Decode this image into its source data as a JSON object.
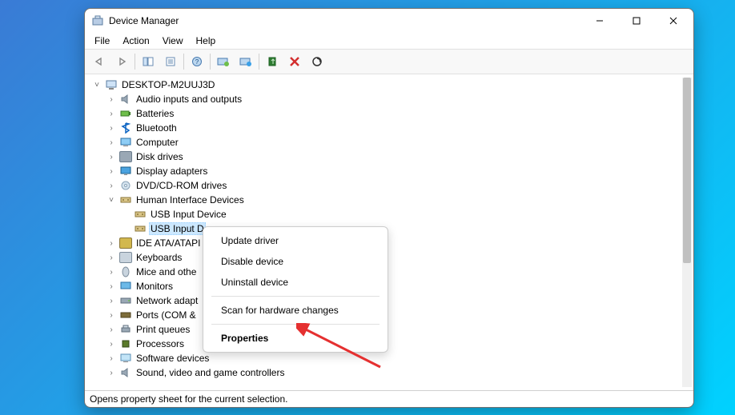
{
  "window": {
    "title": "Device Manager"
  },
  "menu": {
    "file": "File",
    "action": "Action",
    "view": "View",
    "help": "Help"
  },
  "toolbar_icons": [
    "back",
    "forward",
    "up",
    "show-hide",
    "help",
    "update",
    "uninstall",
    "disable",
    "scan",
    "add-legacy",
    "remove",
    "details"
  ],
  "tree": {
    "root": "DESKTOP-M2UUJ3D",
    "nodes": [
      {
        "label": "Audio inputs and outputs",
        "expanded": false
      },
      {
        "label": "Batteries",
        "expanded": false
      },
      {
        "label": "Bluetooth",
        "expanded": false
      },
      {
        "label": "Computer",
        "expanded": false
      },
      {
        "label": "Disk drives",
        "expanded": false
      },
      {
        "label": "Display adapters",
        "expanded": false
      },
      {
        "label": "DVD/CD-ROM drives",
        "expanded": false
      },
      {
        "label": "Human Interface Devices",
        "expanded": true,
        "children": [
          {
            "label": "USB Input Device"
          },
          {
            "label": "USB Input D",
            "selected": true
          }
        ]
      },
      {
        "label": "IDE ATA/ATAPI",
        "expanded": false,
        "truncated": true
      },
      {
        "label": "Keyboards",
        "expanded": false
      },
      {
        "label": "Mice and othe",
        "expanded": false,
        "truncated": true
      },
      {
        "label": "Monitors",
        "expanded": false
      },
      {
        "label": "Network adapt",
        "expanded": false,
        "truncated": true
      },
      {
        "label": "Ports (COM &",
        "expanded": false,
        "truncated": true
      },
      {
        "label": "Print queues",
        "expanded": false
      },
      {
        "label": "Processors",
        "expanded": false
      },
      {
        "label": "Software devices",
        "expanded": false
      },
      {
        "label": "Sound, video and game controllers",
        "expanded": false
      }
    ]
  },
  "context_menu": {
    "update": "Update driver",
    "disable": "Disable device",
    "uninstall": "Uninstall device",
    "scan": "Scan for hardware changes",
    "properties": "Properties"
  },
  "statusbar": "Opens property sheet for the current selection."
}
